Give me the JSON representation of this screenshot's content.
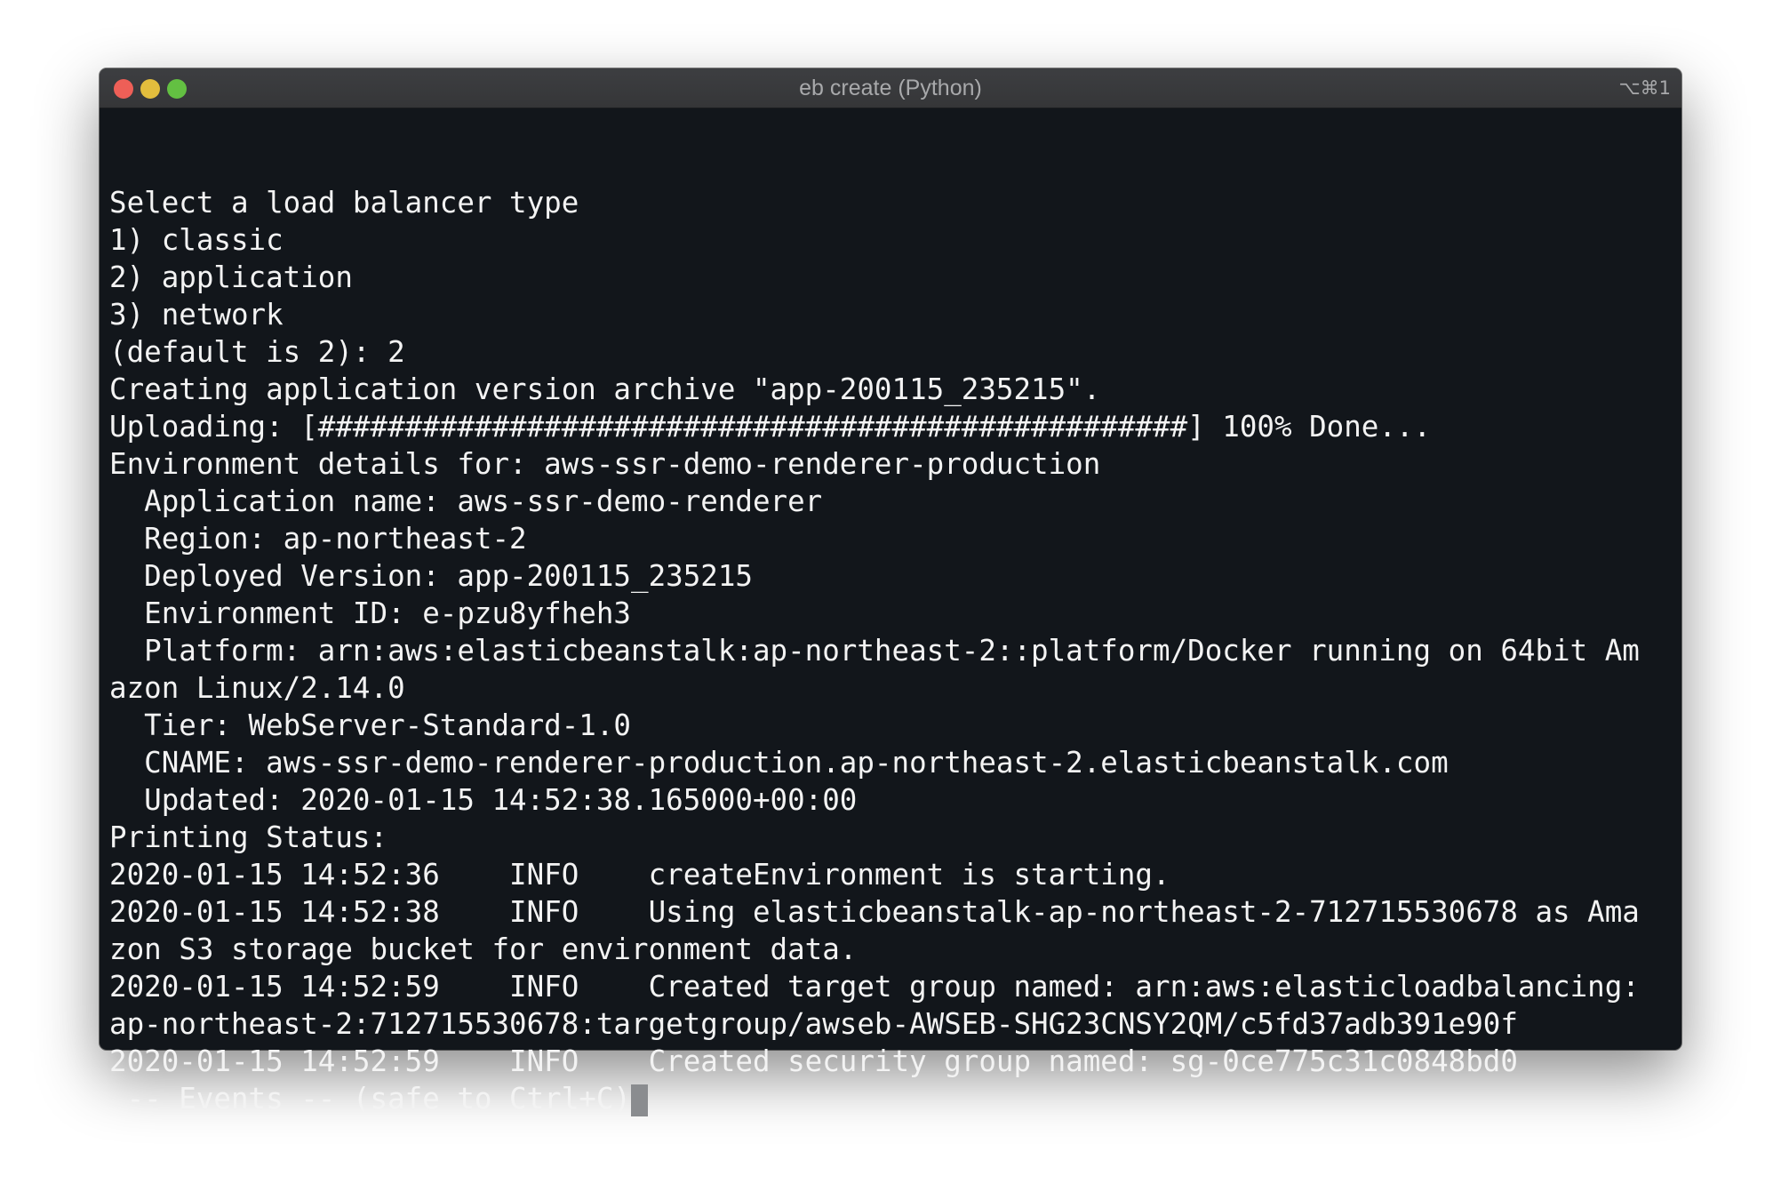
{
  "window": {
    "title": "eb create (Python)",
    "shortcut": "⌥⌘1"
  },
  "terminal": {
    "lines": [
      "Select a load balancer type",
      "1) classic",
      "2) application",
      "3) network",
      "(default is 2): 2",
      "Creating application version archive \"app-200115_235215\".",
      "Uploading: [##################################################] 100% Done...",
      "Environment details for: aws-ssr-demo-renderer-production",
      "  Application name: aws-ssr-demo-renderer",
      "  Region: ap-northeast-2",
      "  Deployed Version: app-200115_235215",
      "  Environment ID: e-pzu8yfheh3",
      "  Platform: arn:aws:elasticbeanstalk:ap-northeast-2::platform/Docker running on 64bit Am",
      "azon Linux/2.14.0",
      "  Tier: WebServer-Standard-1.0",
      "  CNAME: aws-ssr-demo-renderer-production.ap-northeast-2.elasticbeanstalk.com",
      "  Updated: 2020-01-15 14:52:38.165000+00:00",
      "Printing Status:",
      "2020-01-15 14:52:36    INFO    createEnvironment is starting.",
      "2020-01-15 14:52:38    INFO    Using elasticbeanstalk-ap-northeast-2-712715530678 as Ama",
      "zon S3 storage bucket for environment data.",
      "2020-01-15 14:52:59    INFO    Created target group named: arn:aws:elasticloadbalancing:",
      "ap-northeast-2:712715530678:targetgroup/awseb-AWSEB-SHG23CNSY2QM/c5fd37adb391e90f",
      "2020-01-15 14:52:59    INFO    Created security group named: sg-0ce775c31c0848bd0"
    ],
    "prompt_line": " -- Events -- (safe to Ctrl+C)",
    "upload_progress_percent": 100
  }
}
